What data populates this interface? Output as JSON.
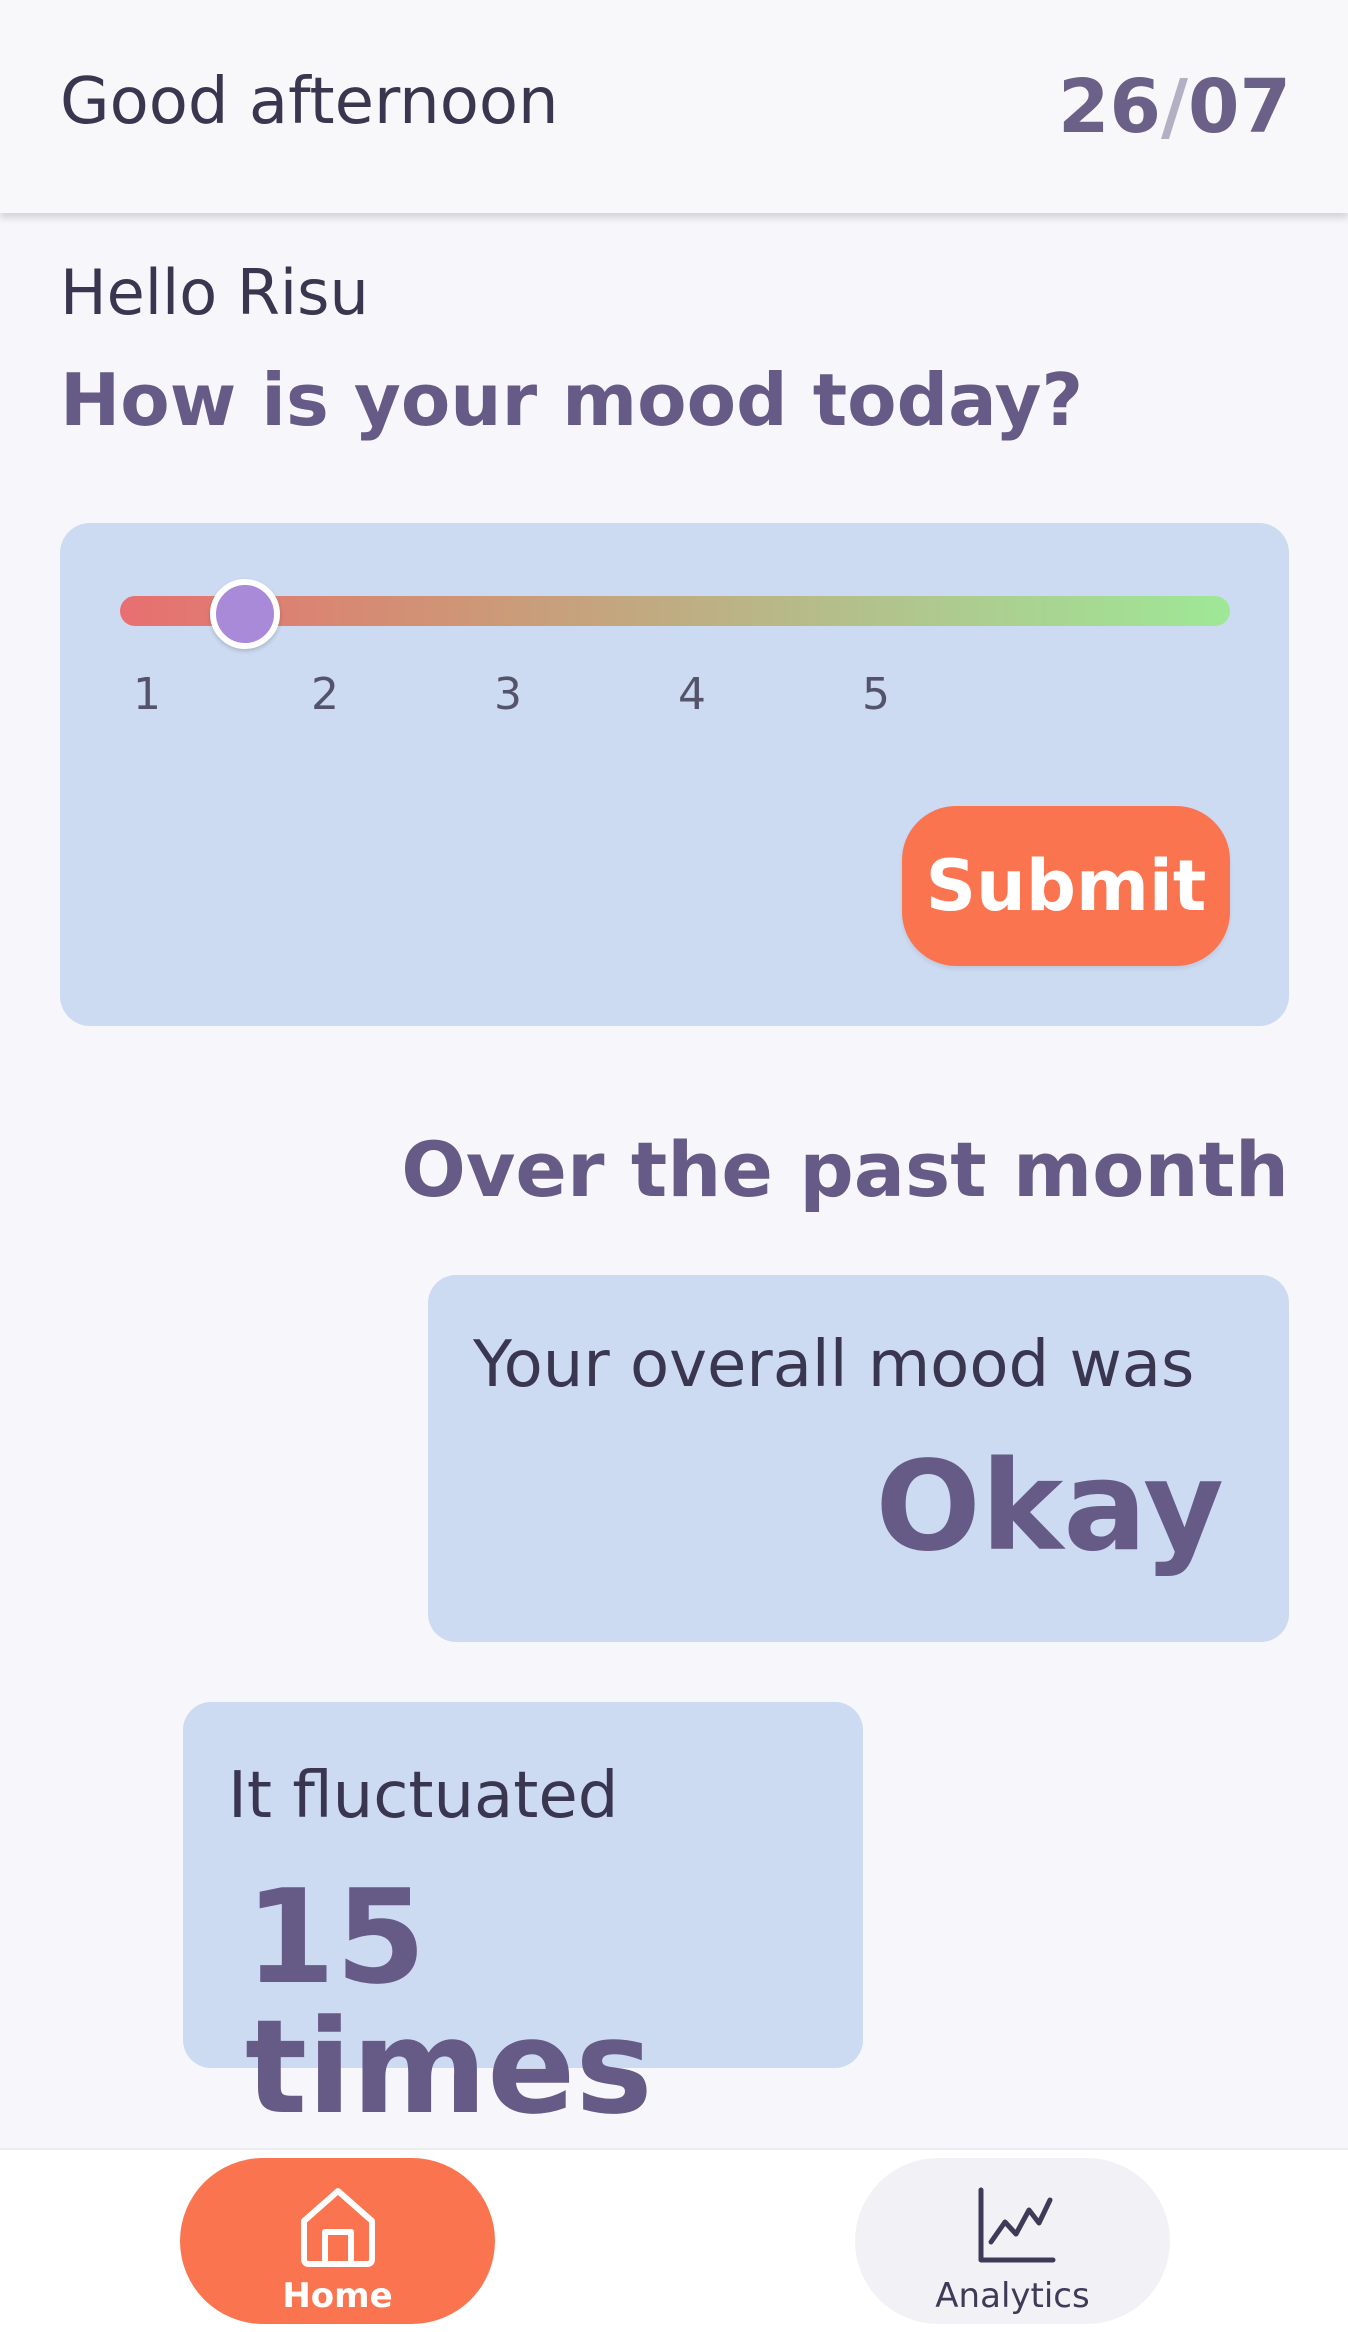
{
  "header": {
    "greeting": "Good afternoon",
    "date_day": "26",
    "date_separator": "/",
    "date_month": "07"
  },
  "mood_prompt": {
    "hello": "Hello Risu",
    "question": "How is your mood today?"
  },
  "mood_slider": {
    "min": 1,
    "max": 5,
    "value": 1.45,
    "ticks": [
      "1",
      "2",
      "3",
      "4",
      "5"
    ],
    "gradient_start": "#e86f70",
    "gradient_end": "#9ee897",
    "thumb_color": "#a98ad8"
  },
  "submit_button": {
    "label": "Submit",
    "color": "#fa754f"
  },
  "summary": {
    "heading": "Over the past month",
    "overall_label": "Your overall mood was",
    "overall_value": "Okay",
    "fluctuation_label": "It fluctuated",
    "fluctuation_value": "15 times"
  },
  "bottom_nav": {
    "items": [
      {
        "label": "Home",
        "icon": "home-icon",
        "active": true
      },
      {
        "label": "Analytics",
        "icon": "analytics-chart-icon",
        "active": false
      }
    ]
  },
  "colors": {
    "accent": "#fa754f",
    "primary_text": "#665a86",
    "card_background": "#cddbf2",
    "page_background": "#f7f7fb"
  }
}
